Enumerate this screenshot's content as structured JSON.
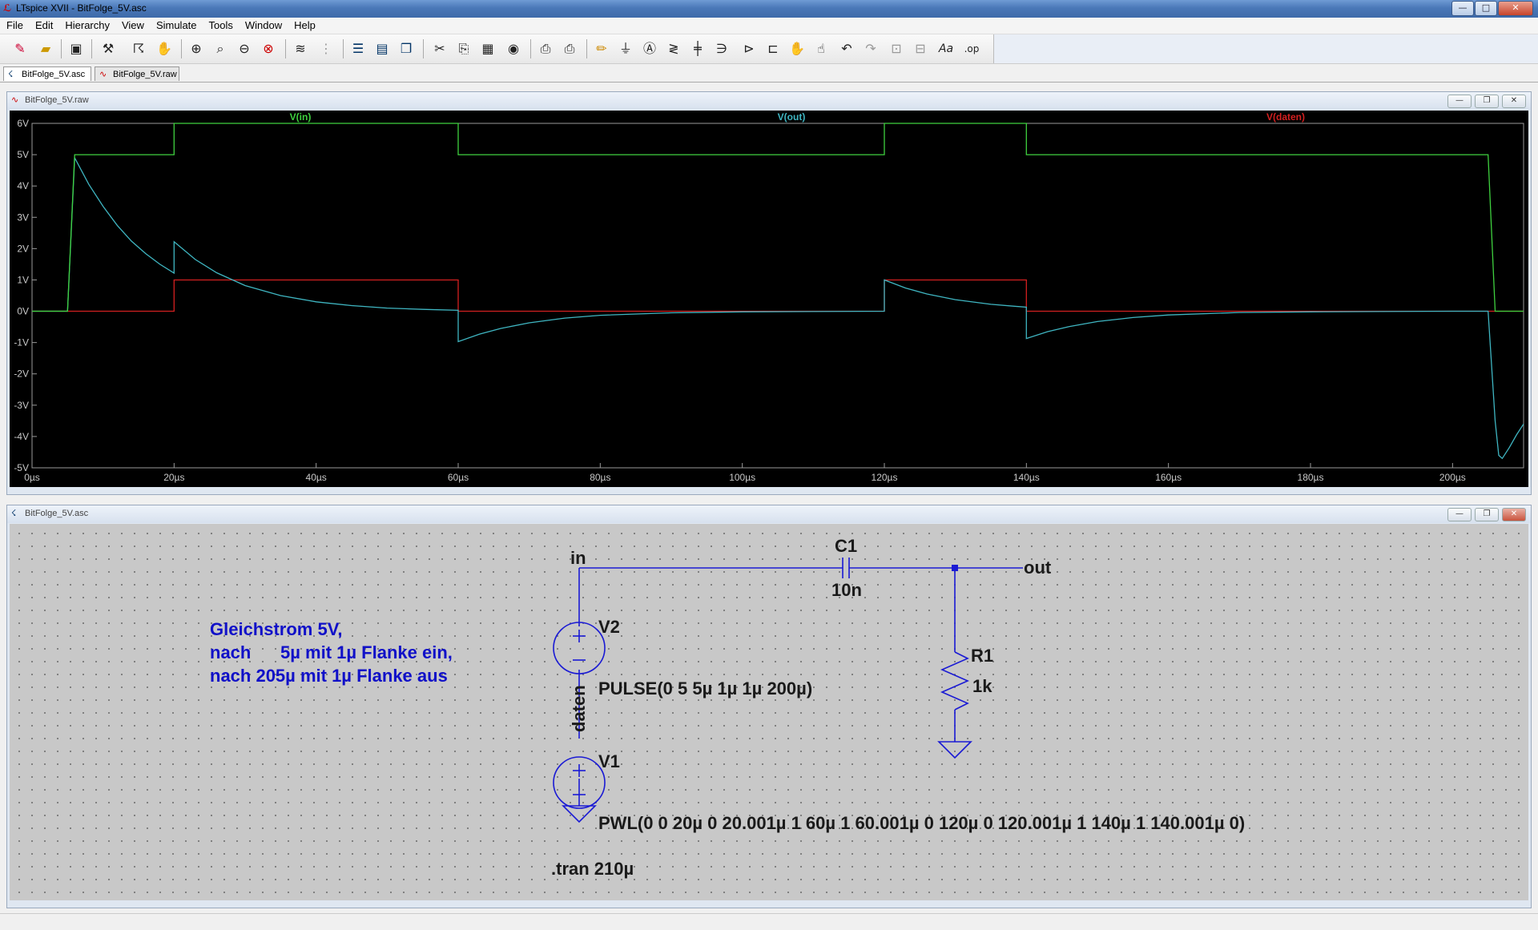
{
  "window": {
    "title": "LTspice XVII - BitFolge_5V.asc",
    "minimize": "—",
    "maximize": "□",
    "close": "✕"
  },
  "menu": [
    "File",
    "Edit",
    "Hierarchy",
    "View",
    "Simulate",
    "Tools",
    "Window",
    "Help"
  ],
  "toolbar_icons": [
    "new-schematic-icon",
    "open-icon",
    "save-icon",
    "control-panel-icon",
    "run-icon",
    "halt-icon",
    "zoom-in-icon",
    "zoom-pan-icon",
    "zoom-out-icon",
    "zoom-fit-icon",
    "autorange-icon",
    "plot-settings-icon",
    "tile-horizontal-icon",
    "tile-vertical-icon",
    "cascade-icon",
    "cut-icon",
    "copy-icon",
    "paste-icon",
    "find-icon",
    "print-setup-icon",
    "print-icon",
    "wire-icon",
    "ground-icon",
    "label-icon",
    "resistor-icon",
    "capacitor-icon",
    "inductor-icon",
    "diode-icon",
    "component-icon",
    "move-icon",
    "drag-icon",
    "undo-icon",
    "redo-icon",
    "rotate-icon",
    "mirror-icon",
    "text-icon",
    "spice-directive-icon"
  ],
  "tabs": [
    {
      "label": "BitFolge_5V.asc",
      "icon": "schematic-icon",
      "active": true
    },
    {
      "label": "BitFolge_5V.raw",
      "icon": "waveform-icon",
      "active": false
    }
  ],
  "waveform_window": {
    "title": "BitFolge_5V.raw",
    "icon": "waveform-icon"
  },
  "schematic_window": {
    "title": "BitFolge_5V.asc",
    "icon": "schematic-icon"
  },
  "chart_data": {
    "type": "line",
    "xlabel": "",
    "ylabel": "",
    "xlim": [
      0,
      210
    ],
    "ylim": [
      -5,
      6
    ],
    "x_unit": "µs",
    "x_ticks": [
      "0µs",
      "20µs",
      "40µs",
      "60µs",
      "80µs",
      "100µs",
      "120µs",
      "140µs",
      "160µs",
      "180µs",
      "200µs"
    ],
    "y_ticks": [
      "6V",
      "5V",
      "4V",
      "3V",
      "2V",
      "1V",
      "0V",
      "-1V",
      "-2V",
      "-3V",
      "-4V",
      "-5V"
    ],
    "grid": false,
    "legend": "top",
    "series": [
      {
        "name": "V(in)",
        "color": "#3fd13f",
        "x": [
          0,
          5,
          6,
          20,
          20.001,
          60,
          60.001,
          120,
          120.001,
          140,
          140.001,
          205,
          206,
          210
        ],
        "y": [
          0,
          0,
          5,
          5,
          6,
          6,
          5,
          5,
          6,
          6,
          5,
          5,
          0,
          0
        ]
      },
      {
        "name": "V(out)",
        "color": "#3fb6c2",
        "x": [
          0,
          5,
          6,
          8,
          10,
          12,
          14,
          16,
          18,
          20,
          20.001,
          23,
          26,
          30,
          35,
          40,
          45,
          50,
          55,
          60,
          60.001,
          63,
          66,
          70,
          75,
          80,
          90,
          100,
          110,
          120,
          120.001,
          123,
          126,
          130,
          135,
          140,
          140.001,
          143,
          146,
          150,
          155,
          160,
          170,
          180,
          190,
          200,
          205,
          206,
          206.5,
          207,
          208,
          209,
          210
        ],
        "y": [
          0,
          0,
          4.9,
          4.05,
          3.35,
          2.74,
          2.24,
          1.84,
          1.5,
          1.22,
          2.22,
          1.65,
          1.23,
          0.82,
          0.5,
          0.3,
          0.18,
          0.1,
          0.06,
          0.03,
          -0.97,
          -0.73,
          -0.55,
          -0.37,
          -0.22,
          -0.13,
          -0.05,
          -0.02,
          -0.01,
          0,
          1,
          0.74,
          0.55,
          0.37,
          0.22,
          0.13,
          -0.87,
          -0.65,
          -0.49,
          -0.33,
          -0.2,
          -0.12,
          -0.04,
          -0.02,
          -0.01,
          0,
          0,
          -3.5,
          -4.6,
          -4.7,
          -4.35,
          -3.95,
          -3.6
        ]
      },
      {
        "name": "V(daten)",
        "color": "#d42020",
        "x": [
          0,
          20,
          20.001,
          60,
          60.001,
          120,
          120.001,
          140,
          140.001,
          210
        ],
        "y": [
          0,
          0,
          1,
          1,
          0,
          0,
          1,
          1,
          0,
          0
        ]
      }
    ]
  },
  "schematic": {
    "net_in": "in",
    "net_out": "out",
    "net_daten": "daten",
    "c1_name": "C1",
    "c1_value": "10n",
    "r1_name": "R1",
    "r1_value": "1k",
    "v2_name": "V2",
    "v2_value": "PULSE(0 5 5µ 1µ 1µ 200µ)",
    "v1_name": "V1",
    "v1_value": "PWL(0 0 20µ 0 20.001µ 1 60µ 1 60.001µ 0 120µ 0 120.001µ 1 140µ 1 140.001µ 0)",
    "directive": ".tran 210µ",
    "comment": [
      "Gleichstrom 5V,",
      "nach      5µ mit 1µ Flanke ein,",
      "nach 205µ mit 1µ Flanke aus"
    ],
    "wire_color": "#1a1ad4",
    "comment_color": "#1010c8"
  }
}
